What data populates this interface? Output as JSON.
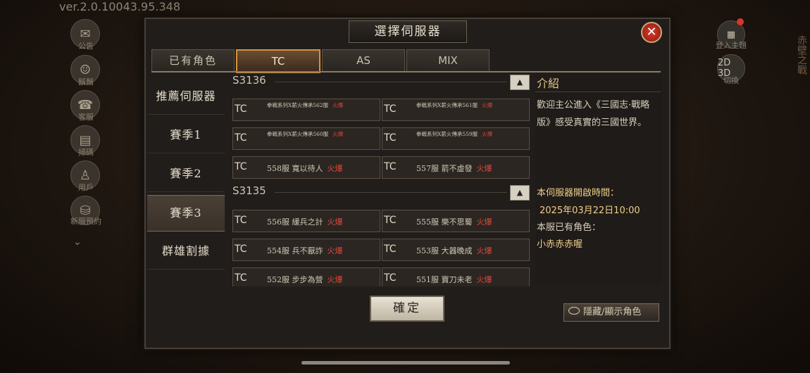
{
  "version": "ver.2.0.10043.95.348",
  "side_icons": [
    {
      "icon": "announcement-icon",
      "label": "公告"
    },
    {
      "icon": "beard-icon",
      "label": "鬍鬚"
    },
    {
      "icon": "service-icon",
      "label": "客服"
    },
    {
      "icon": "scan-icon",
      "label": "掃碼"
    },
    {
      "icon": "user-icon",
      "label": "用戶"
    },
    {
      "icon": "server-icon",
      "label": "新服預約"
    }
  ],
  "right_icons": [
    {
      "icon": "grid-icon",
      "label": "登入主題"
    },
    {
      "icon": "2d3d-icon",
      "text": "2D 3D",
      "label": "切換"
    }
  ],
  "deco_text": "赤壁之戰",
  "dialog": {
    "title": "選擇伺服器",
    "close_symbol": "✕",
    "tabs": [
      {
        "label": "已有角色",
        "active": false
      },
      {
        "label": "TC",
        "active": true
      },
      {
        "label": "AS",
        "active": false
      },
      {
        "label": "MIX",
        "active": false
      }
    ],
    "nav": [
      {
        "label": "推薦伺服器",
        "selected": false
      },
      {
        "label": "賽季1",
        "selected": false
      },
      {
        "label": "賽季2",
        "selected": false
      },
      {
        "label": "賽季3",
        "selected": true
      },
      {
        "label": "群雄割據",
        "selected": false
      }
    ],
    "seasons": [
      {
        "label": "S3136",
        "collapse": "▲",
        "servers": [
          {
            "region": "TC",
            "name": "拳戰系列X薪火傳承562服",
            "hot": "火爆",
            "small": true
          },
          {
            "region": "TC",
            "name": "拳戰系列X薪火傳承561服",
            "hot": "火爆",
            "small": true
          },
          {
            "region": "TC",
            "name": "拳戰系列X薪火傳承560服",
            "hot": "火爆",
            "small": true
          },
          {
            "region": "TC",
            "name": "拳戰系列X薪火傳承559服",
            "hot": "火爆",
            "small": true
          },
          {
            "region": "TC",
            "name": "558服  寬以待人",
            "hot": "火爆",
            "small": false
          },
          {
            "region": "TC",
            "name": "557服  箭不虛發",
            "hot": "火爆",
            "small": false
          }
        ]
      },
      {
        "label": "S3135",
        "collapse": "▲",
        "servers": [
          {
            "region": "TC",
            "name": "556服  緩兵之計",
            "hot": "火爆",
            "small": false
          },
          {
            "region": "TC",
            "name": "555服  樂不思蜀",
            "hot": "火爆",
            "small": false
          },
          {
            "region": "TC",
            "name": "554服  兵不厭詐",
            "hot": "火爆",
            "small": false
          },
          {
            "region": "TC",
            "name": "553服  大器晚成",
            "hot": "火爆",
            "small": false
          },
          {
            "region": "TC",
            "name": "552服  步步為營",
            "hot": "火爆",
            "small": false
          },
          {
            "region": "TC",
            "name": "551服  寶刀未老",
            "hot": "火爆",
            "small": false
          }
        ]
      }
    ],
    "intro": {
      "title": "介紹",
      "welcome": "歡迎主公進入《三國志·戰略版》感受真實的三國世界。",
      "open_time_label": "本伺服器開啟時間：",
      "open_time": "2025年03月22日10:00",
      "roles_label": "本服已有角色：",
      "role_name": "小赤赤赤喔"
    },
    "confirm_label": "確定",
    "toggle_label": "隱藏/顯示角色"
  }
}
